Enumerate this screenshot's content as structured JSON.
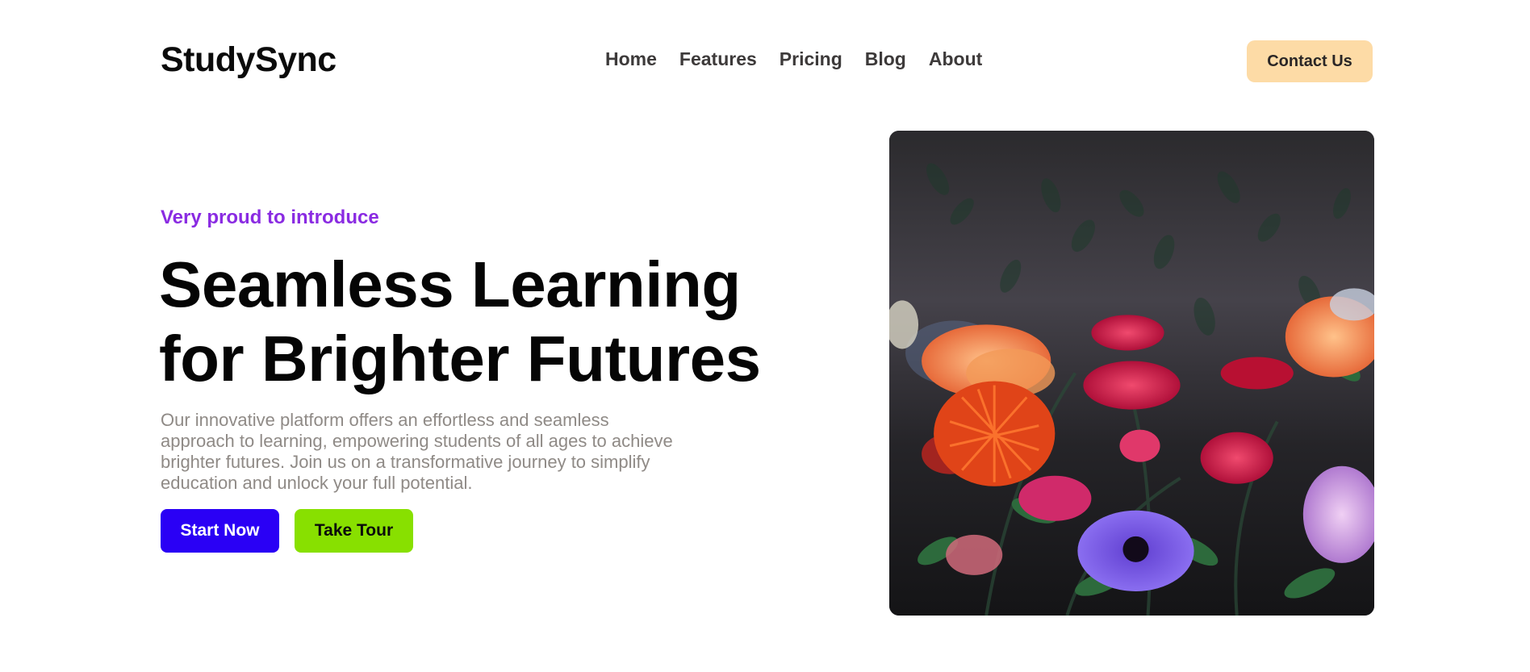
{
  "header": {
    "logo": "StudySync",
    "nav": [
      "Home",
      "Features",
      "Pricing",
      "Blog",
      "About"
    ],
    "contact_label": "Contact Us"
  },
  "hero": {
    "eyebrow": "Very proud to introduce",
    "headline_line1": "Seamless Learning",
    "headline_line2": "for Brighter Futures",
    "description": "Our innovative platform offers an effortless and seamless approach to learning, empowering students of all ages to achieve brighter futures. Join us on a transformative journey to simplify education and unlock your full potential.",
    "primary_cta": "Start Now",
    "secondary_cta": "Take Tour",
    "image": "flower-bouquet-photo"
  },
  "colors": {
    "accent_purple": "#8a2be2",
    "primary_button": "#2a00f5",
    "secondary_button": "#88e000",
    "contact_button": "#fddba6",
    "body_text": "#8f8a86"
  }
}
